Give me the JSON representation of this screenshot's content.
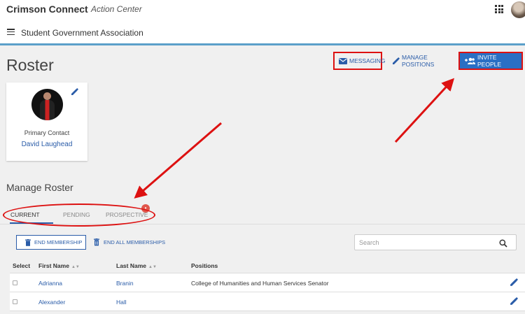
{
  "header": {
    "app_name": "Crimson Connect",
    "app_subtitle": "Action Center",
    "org_name": "Student Government Association",
    "apps_icon": "apps-grid-icon",
    "menu_icon": "hamburger-menu-icon"
  },
  "page": {
    "title": "Roster"
  },
  "toolbar": {
    "messaging_label": "MESSAGING",
    "manage_positions_label": "MANAGE POSITIONS",
    "invite_people_label": "INVITE PEOPLE"
  },
  "contact": {
    "label": "Primary Contact",
    "name": "David Laughead"
  },
  "manage": {
    "title": "Manage Roster",
    "tabs": [
      {
        "label": "CURRENT",
        "active": true
      },
      {
        "label": "PENDING",
        "active": false
      },
      {
        "label": "PROSPECTIVE",
        "active": false
      }
    ],
    "end_membership_label": "END MEMBERSHIP",
    "end_all_label": "END ALL MEMBERSHIPS",
    "search_placeholder": "Search"
  },
  "table": {
    "columns": [
      "Select",
      "First Name",
      "Last Name",
      "Positions"
    ],
    "rows": [
      {
        "first": "Adrianna",
        "last": "Branin",
        "position": "College of Humanities and Human Services Senator"
      },
      {
        "first": "Alexander",
        "last": "Hall",
        "position": ""
      }
    ]
  },
  "colors": {
    "accent": "#2a5ca8",
    "primary_button": "#2a6fc4",
    "annotation_red": "#dd1111",
    "header_rule": "#5b9fc9"
  }
}
